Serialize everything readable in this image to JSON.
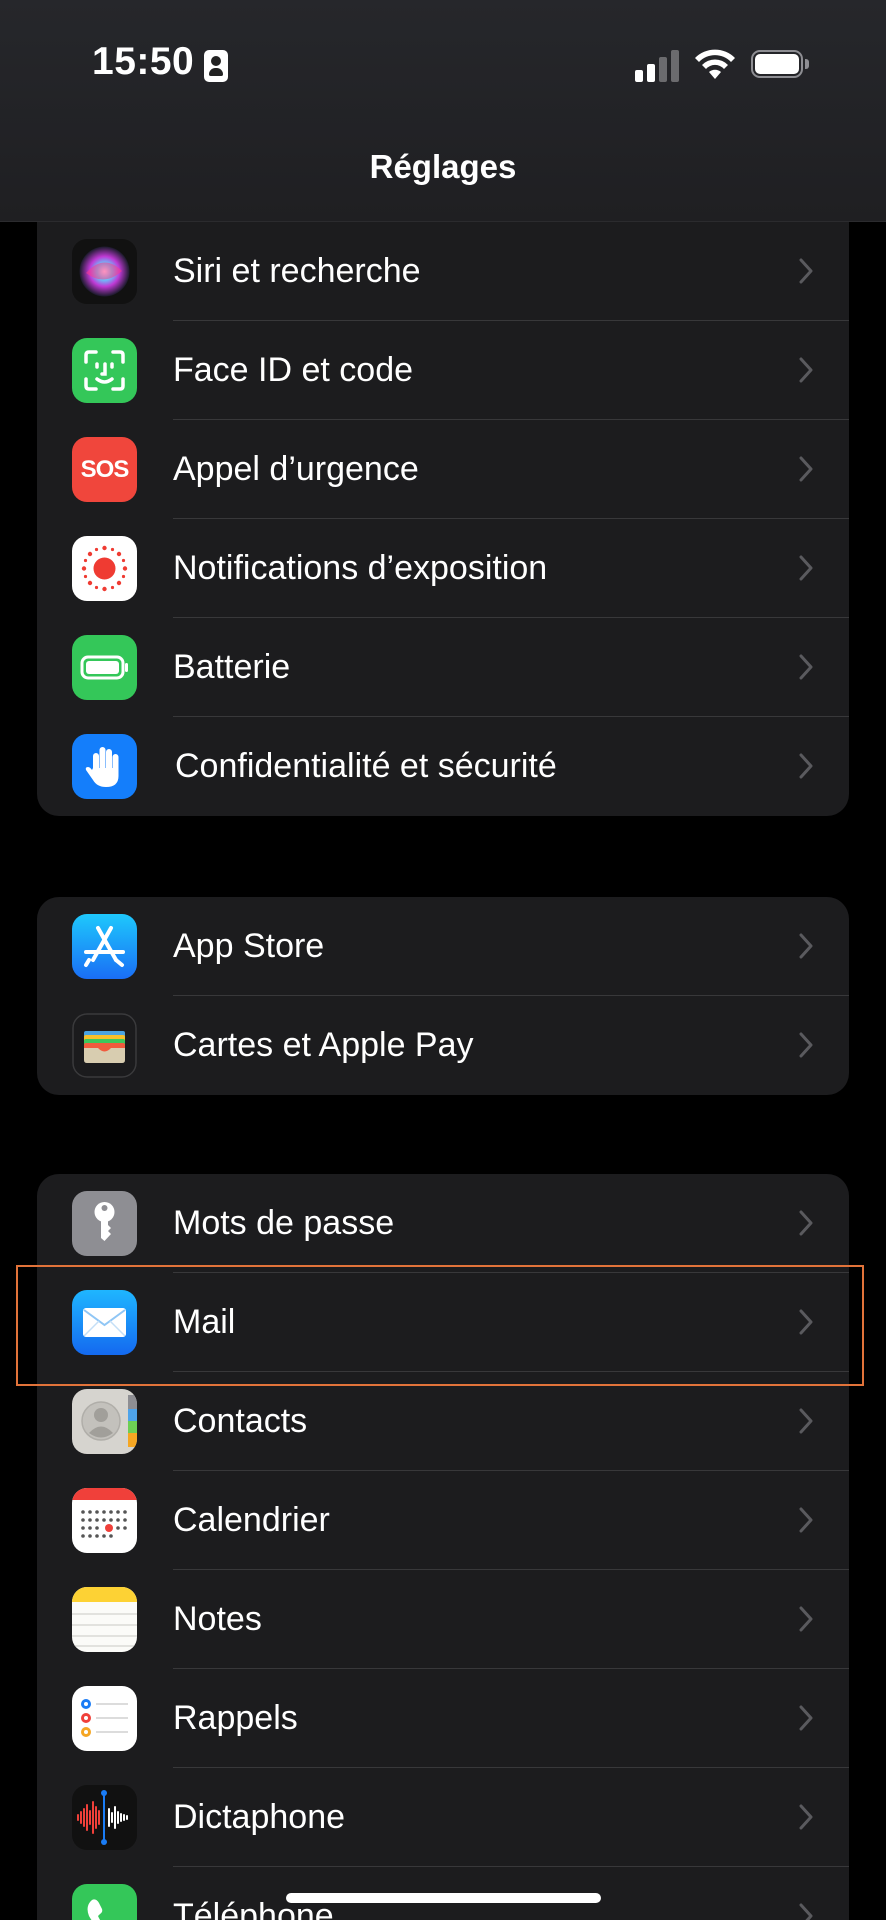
{
  "status_bar": {
    "time": "15:50"
  },
  "nav": {
    "title": "Réglages"
  },
  "group1": [
    {
      "label": "Siri et recherche",
      "icon": "siri-icon"
    },
    {
      "label": "Face ID et code",
      "icon": "face-id-icon"
    },
    {
      "label": "Appel d’urgence",
      "icon": "sos-icon",
      "icon_text": "SOS"
    },
    {
      "label": "Notifications d’exposition",
      "icon": "exposure-notifications-icon"
    },
    {
      "label": "Batterie",
      "icon": "battery-icon"
    },
    {
      "label": "Confidentialité et sécurité",
      "icon": "privacy-hand-icon"
    }
  ],
  "group2": [
    {
      "label": "App Store",
      "icon": "app-store-icon"
    },
    {
      "label": "Cartes et Apple Pay",
      "icon": "wallet-icon"
    }
  ],
  "group3": [
    {
      "label": "Mots de passe",
      "icon": "key-icon"
    },
    {
      "label": "Mail",
      "icon": "mail-icon"
    },
    {
      "label": "Contacts",
      "icon": "contacts-icon"
    },
    {
      "label": "Calendrier",
      "icon": "calendar-icon"
    },
    {
      "label": "Notes",
      "icon": "notes-icon"
    },
    {
      "label": "Rappels",
      "icon": "reminders-icon"
    },
    {
      "label": "Dictaphone",
      "icon": "voice-memos-icon"
    },
    {
      "label": "Téléphone",
      "icon": "phone-icon"
    }
  ],
  "colors": {
    "background": "#000000",
    "group_background": "#1c1c1e",
    "separator": "#38383a",
    "chevron": "#5a5a5e",
    "highlight": "#e2733a"
  }
}
